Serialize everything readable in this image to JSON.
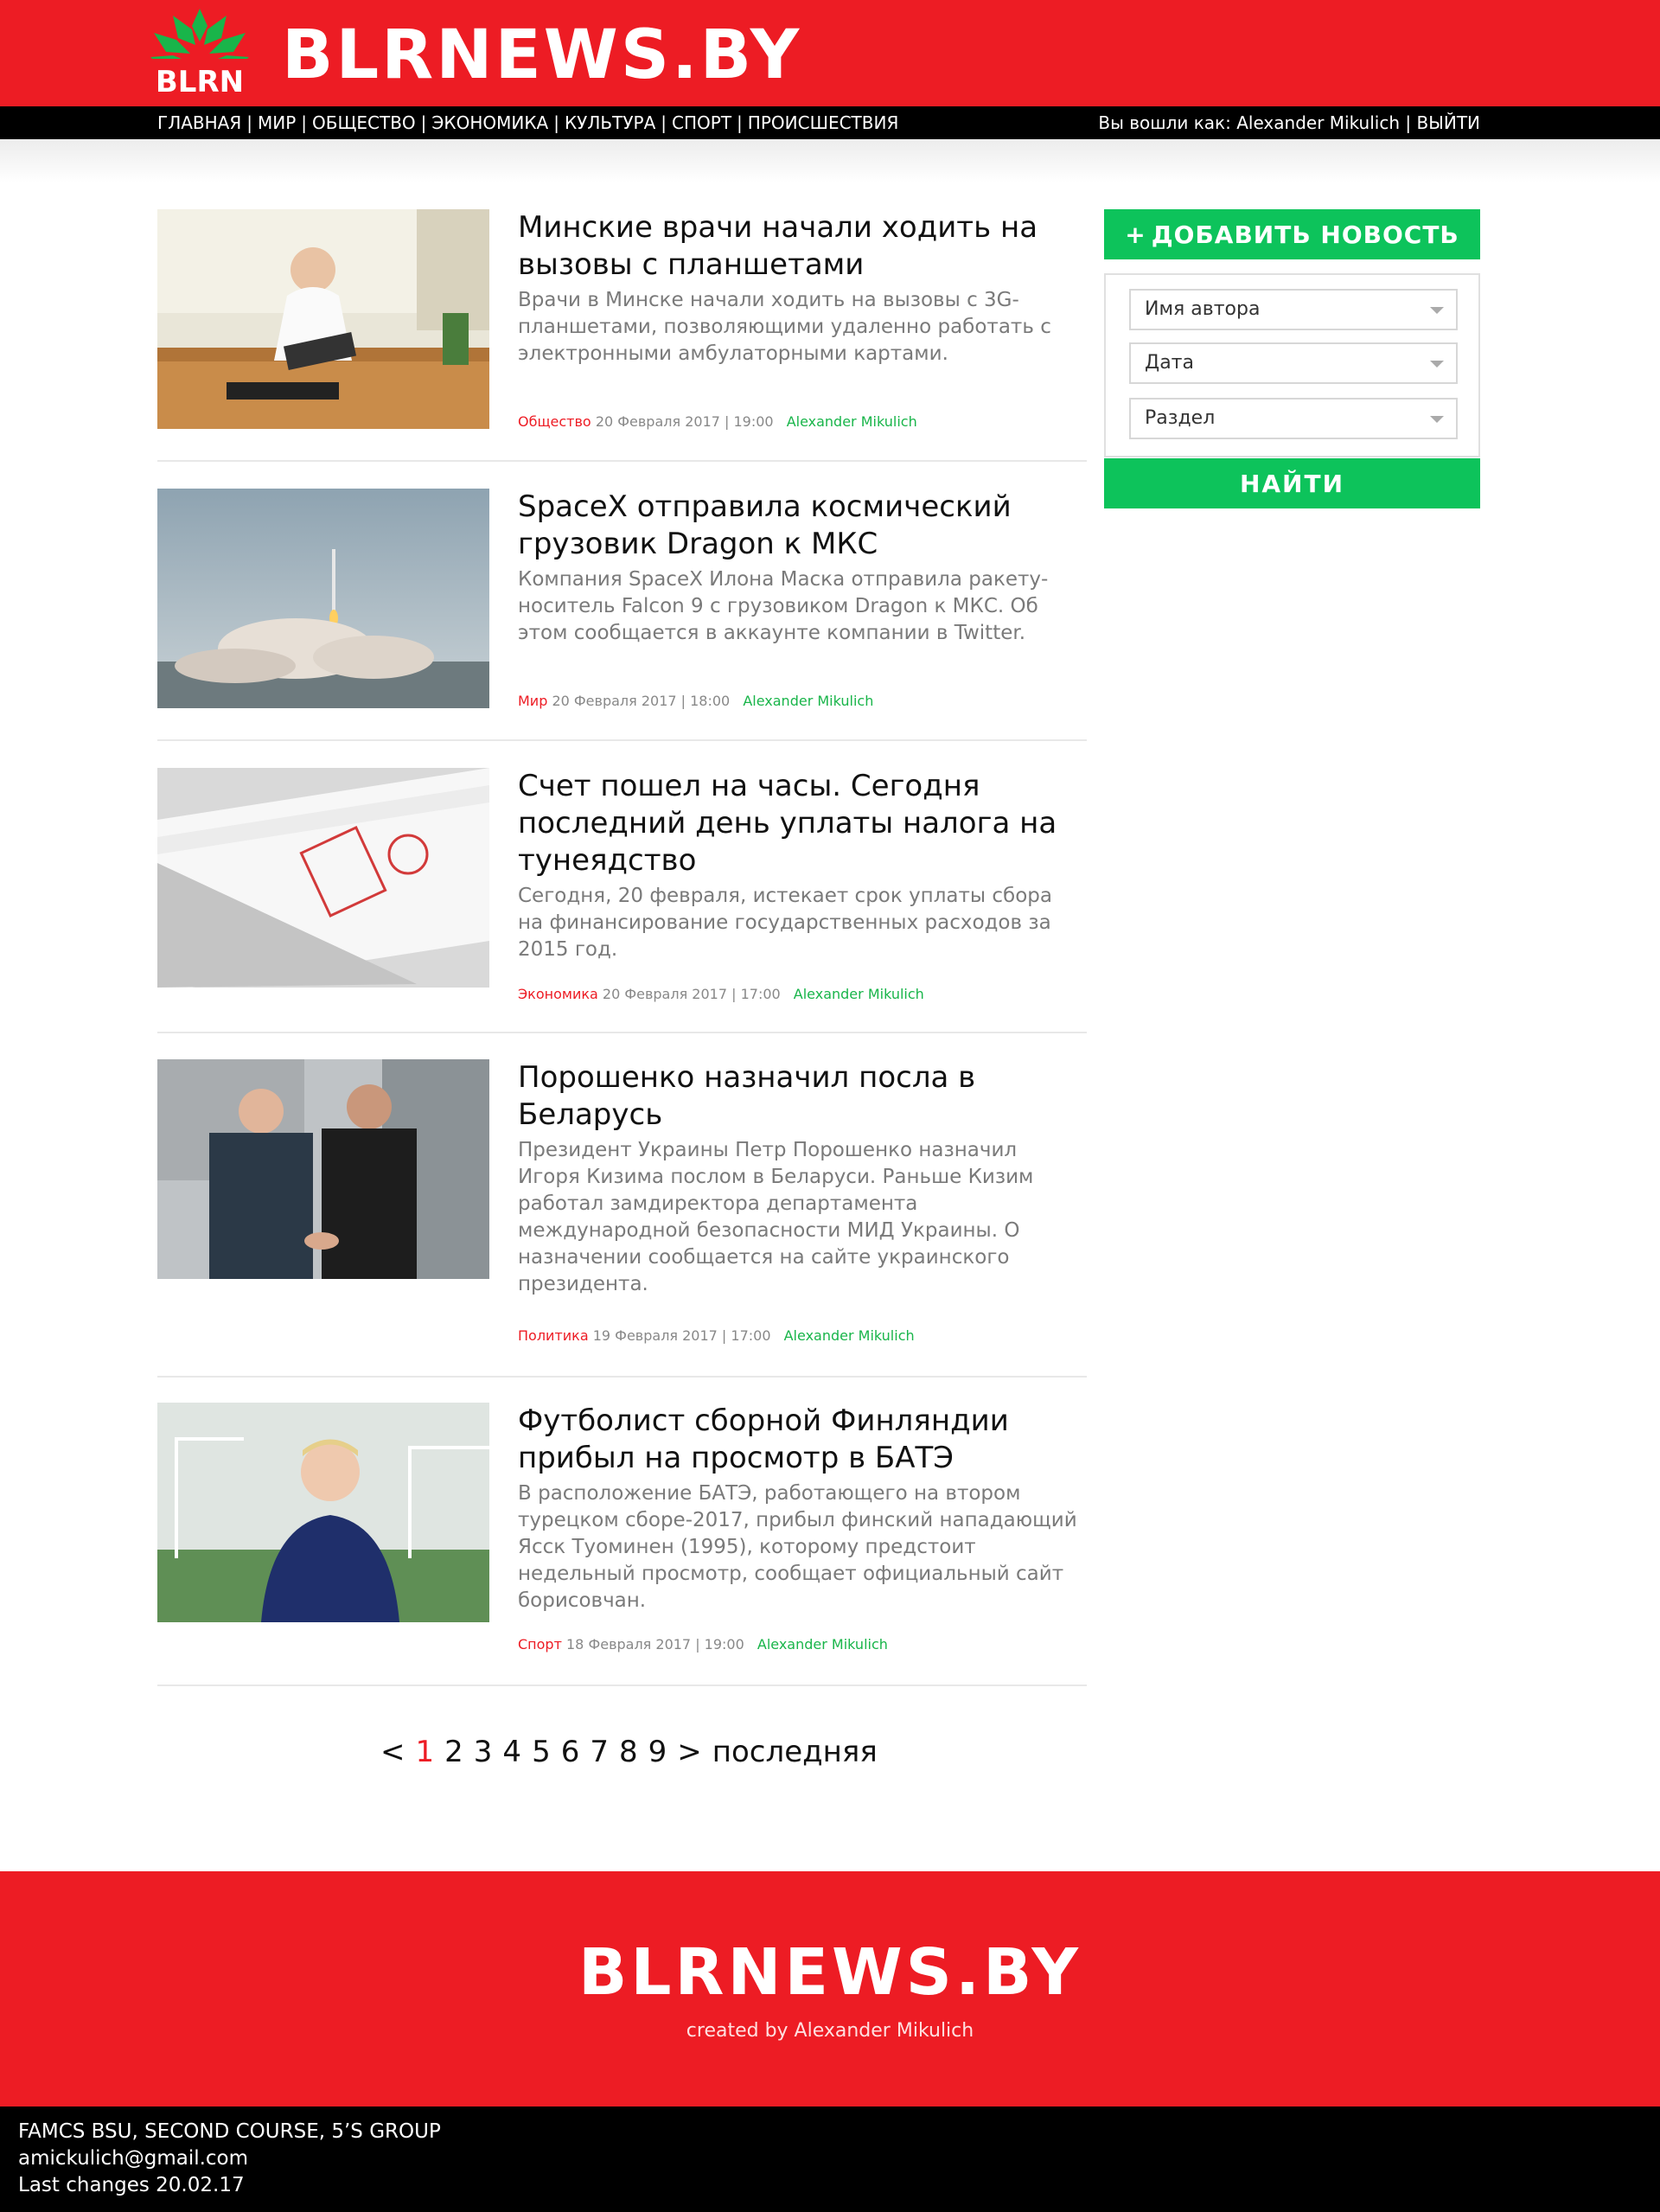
{
  "header": {
    "logo_text": "BLRN",
    "brand": "BLRNEWS.BY"
  },
  "nav": {
    "items": [
      "ГЛАВНАЯ",
      "МИР",
      "ОБЩЕСТВО",
      "ЭКОНОМИКА",
      "КУЛЬТУРА",
      "СПОРТ",
      "ПРОИСШЕСТВИЯ"
    ],
    "separator": "|",
    "user_label": "Вы вошли как:",
    "user_name": "Alexander Mikulich",
    "logout": "ВЫЙТИ"
  },
  "articles": [
    {
      "title": "Минские врачи начали ходить на вызовы с планшетами",
      "excerpt": "Врачи в Минске начали ходить на вызовы с 3G-планшетами, позволяющими удаленно работать с электронными амбулаторными картами.",
      "category": "Общество",
      "date": "20 Февраля 2017 | 19:00",
      "author": "Alexander Mikulich"
    },
    {
      "title": "SpaceX отправила космический грузовик Dragon к МКС",
      "excerpt": "Компания SpaceX Илона Маска отправила ракету-носитель Falcon 9 с грузовиком Dragon к МКС. Об этом сообщается в аккаунте компании в Twitter.",
      "category": "Мир",
      "date": "20 Февраля 2017 | 18:00",
      "author": "Alexander Mikulich"
    },
    {
      "title": "Счет пошел на часы. Сегодня последний день уплаты налога на тунеядство",
      "excerpt": "Сегодня, 20 февраля, истекает срок уплаты сбора на финансирование государственных расходов за 2015 год.",
      "category": "Экономика",
      "date": "20 Февраля 2017 | 17:00",
      "author": "Alexander Mikulich"
    },
    {
      "title": "Порошенко назначил посла в Беларусь",
      "excerpt": "Президент Украины Петр Порошенко назначил Игоря Кизима послом в Беларуси. Раньше Кизим работал замдиректора департамента международной безопасности МИД Украины. О назначении сообщается на сайте украинского президента.",
      "category": "Политика",
      "date": "19 Февраля 2017 | 17:00",
      "author": "Alexander Mikulich"
    },
    {
      "title": "Футболист сборной Финляндии прибыл на просмотр в БАТЭ",
      "excerpt": "В расположение БАТЭ, работающего на втором турецком сборе-2017, прибыл финский нападающий Ясск Туоминен (1995), которому предстоит недельный просмотр, сообщает официальный сайт борисовчан.",
      "category": "Спорт",
      "date": "18 Февраля 2017 | 19:00",
      "author": "Alexander Mikulich"
    }
  ],
  "sidebar": {
    "add_button": "ДОБАВИТЬ НОВОСТЬ",
    "add_icon": "+",
    "filters": [
      "Имя автора",
      "Дата",
      "Раздел"
    ],
    "find_button": "НАЙТИ"
  },
  "pagination": {
    "prev": "<",
    "pages": [
      "1",
      "2",
      "3",
      "4",
      "5",
      "6",
      "7",
      "8",
      "9"
    ],
    "current": "1",
    "next": ">",
    "last": "последняя"
  },
  "footer": {
    "brand": "BLRNEWS.BY",
    "credit": "created by Alexander Mikulich",
    "lines": [
      "FAMCS BSU, SECOND COURSE, 5’S GROUP",
      "amickulich@gmail.com",
      "Last changes 20.02.17"
    ]
  },
  "colors": {
    "brand_red": "#ed1c24",
    "accent_green": "#0dc35b",
    "author_green": "#19b54a"
  }
}
